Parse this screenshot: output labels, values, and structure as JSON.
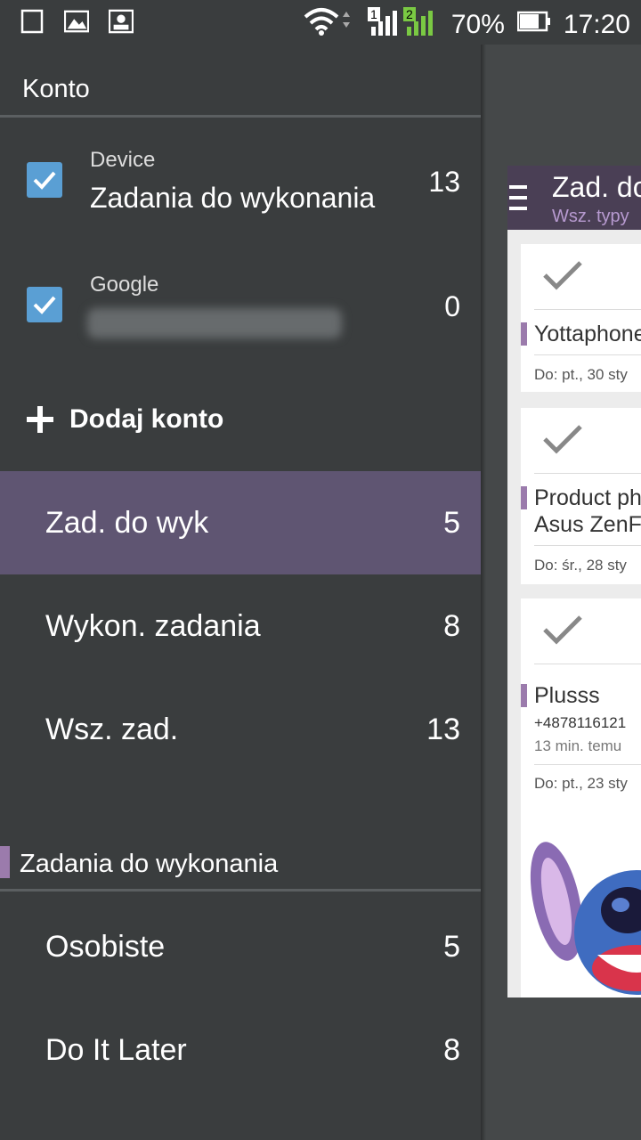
{
  "status_bar": {
    "sim_label": "1",
    "signal1_label": "1",
    "signal2_label": "2",
    "battery_percent": "70%",
    "time": "17:20",
    "icons": [
      "sim-icon",
      "image-icon",
      "rec-icon",
      "wifi-icon",
      "signal-icon",
      "battery-icon"
    ]
  },
  "drawer": {
    "account_section_title": "Konto",
    "accounts": [
      {
        "source": "Device",
        "name": "Zadania do wykonania",
        "count": "13",
        "checked": true
      },
      {
        "source": "Google",
        "name": "",
        "count": "0",
        "checked": true
      }
    ],
    "add_account_label": "Dodaj konto",
    "filters": [
      {
        "label": "Zad. do wyk",
        "count": "5",
        "active": true
      },
      {
        "label": "Wykon. zadania",
        "count": "8",
        "active": false
      },
      {
        "label": "Wsz. zad.",
        "count": "13",
        "active": false
      }
    ],
    "list_section_title": "Zadania do wykonania",
    "lists": [
      {
        "label": "Osobiste",
        "count": "5"
      },
      {
        "label": "Do It Later",
        "count": "8"
      }
    ]
  },
  "preview": {
    "title": "Zad. do wyk",
    "subtitle": "Wsz. typy",
    "cards": [
      {
        "title": "Yottaphone",
        "due": "Do: pt., 30 sty"
      },
      {
        "title_line1": "Product ph",
        "title_line2": "Asus ZenF",
        "due": "Do: śr., 28 sty"
      },
      {
        "title": "Plusss",
        "phone": "+4878116121",
        "time_ago": "13 min. temu",
        "due": "Do: pt., 23 sty"
      }
    ]
  },
  "colors": {
    "drawer_bg": "#3a3d3e",
    "active_item": "#5f5572",
    "accent_purple": "#9b7bac",
    "checkbox_blue": "#5a9fd4",
    "preview_header": "#4a3f55"
  }
}
